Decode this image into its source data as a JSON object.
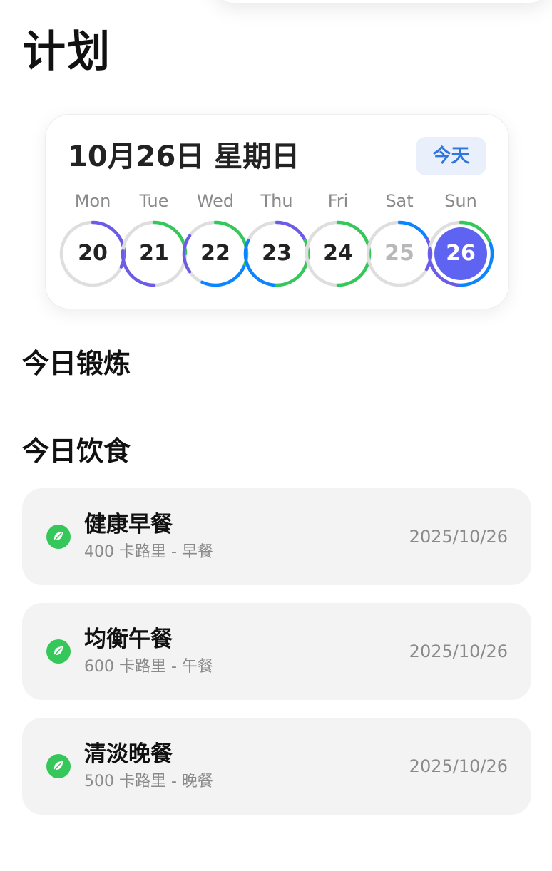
{
  "page": {
    "title": "计划"
  },
  "calendar": {
    "date_title": "10月26日 星期日",
    "today_button": "今天",
    "days": [
      {
        "label": "Mon",
        "number": "20",
        "state": "past",
        "rings": [
          {
            "color": "#6b5ce7",
            "start": -90,
            "sweep": 115
          }
        ]
      },
      {
        "label": "Tue",
        "number": "21",
        "state": "past",
        "rings": [
          {
            "color": "#34c759",
            "start": -90,
            "sweep": 90
          },
          {
            "color": "#6b5ce7",
            "start": 90,
            "sweep": 95
          }
        ]
      },
      {
        "label": "Wed",
        "number": "22",
        "state": "past",
        "rings": [
          {
            "color": "#34c759",
            "start": -90,
            "sweep": 115
          },
          {
            "color": "#0a84ff",
            "start": 25,
            "sweep": 90
          },
          {
            "color": "#6b5ce7",
            "start": 145,
            "sweep": 70
          }
        ]
      },
      {
        "label": "Thu",
        "number": "23",
        "state": "past",
        "rings": [
          {
            "color": "#6b5ce7",
            "start": -90,
            "sweep": 115
          },
          {
            "color": "#34c759",
            "start": -25,
            "sweep": 120
          },
          {
            "color": "#0a84ff",
            "start": 95,
            "sweep": 110
          }
        ]
      },
      {
        "label": "Fri",
        "number": "24",
        "state": "past",
        "rings": [
          {
            "color": "#34c759",
            "start": -90,
            "sweep": 180
          }
        ]
      },
      {
        "label": "Sat",
        "number": "25",
        "state": "future",
        "rings": [
          {
            "color": "#0a84ff",
            "start": -90,
            "sweep": 60
          },
          {
            "color": "#6b5ce7",
            "start": -30,
            "sweep": 60
          }
        ]
      },
      {
        "label": "Sun",
        "number": "26",
        "state": "selected",
        "rings": [
          {
            "color": "#34c759",
            "start": -90,
            "sweep": 65
          },
          {
            "color": "#0a84ff",
            "start": -20,
            "sweep": 115
          },
          {
            "color": "#6b5ce7",
            "start": 95,
            "sweep": 95
          }
        ]
      }
    ]
  },
  "sections": {
    "workout_title": "今日锻炼",
    "diet_title": "今日饮食"
  },
  "meals": [
    {
      "name": "健康早餐",
      "meta": "400 卡路里 - 早餐",
      "date": "2025/10/26",
      "icon": "leaf-icon"
    },
    {
      "name": "均衡午餐",
      "meta": "600 卡路里 - 午餐",
      "date": "2025/10/26",
      "icon": "leaf-icon"
    },
    {
      "name": "清淡晚餐",
      "meta": "500 卡路里 - 晚餐",
      "date": "2025/10/26",
      "icon": "leaf-icon"
    }
  ],
  "colors": {
    "accent_blue": "#2f77dd",
    "selected_day": "#5f63f2",
    "meal_icon": "#35c759",
    "ring_track": "#dedede"
  }
}
